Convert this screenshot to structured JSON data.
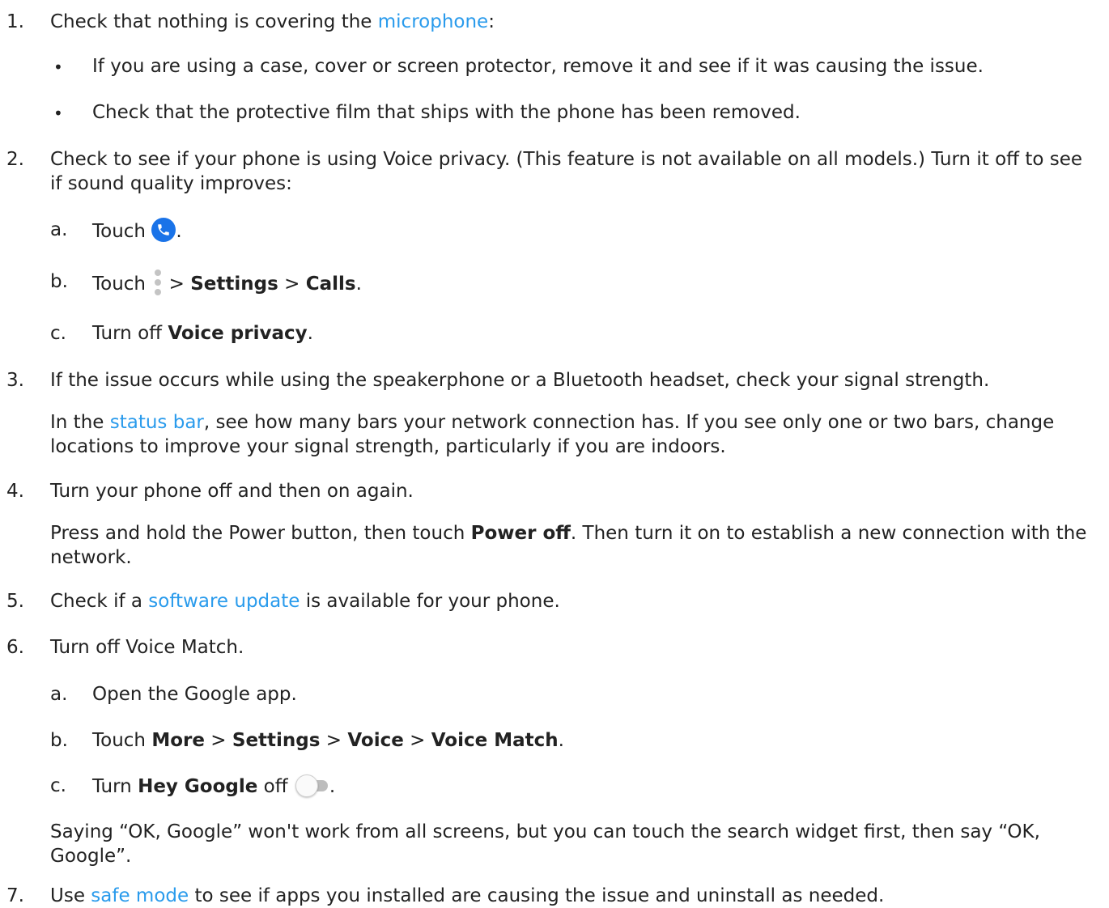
{
  "steps": [
    {
      "num": "1.",
      "text_before": "Check that nothing is covering the ",
      "link": "microphone",
      "text_after": ":",
      "bullets": [
        "If you are using a case, cover or screen protector, remove it and see if it was causing the issue.",
        "Check that the protective film that ships with the phone has been removed."
      ]
    },
    {
      "num": "2.",
      "text": "Check to see if your phone is using Voice privacy. (This feature is not available on all models.) Turn it off to see if sound quality improves:",
      "substeps": [
        {
          "label": "a.",
          "touch": "Touch",
          "end": "."
        },
        {
          "label": "b.",
          "touch": "Touch",
          "sep1": " > ",
          "settings": "Settings",
          "sep2": " > ",
          "calls": "Calls",
          "end": "."
        },
        {
          "label": "c.",
          "prefix": "Turn off ",
          "bold": "Voice privacy",
          "end": "."
        }
      ]
    },
    {
      "num": "3.",
      "text": "If the issue occurs while using the speakerphone or a Bluetooth headset, check your signal strength.",
      "para_before": "In the ",
      "para_link": "status bar",
      "para_after": ", see how many bars your network connection has. If you see only one or two bars, change locations to improve your signal strength, particularly if you are indoors."
    },
    {
      "num": "4.",
      "text": "Turn your phone off and then on again.",
      "para_before": "Press and hold the Power button, then touch ",
      "para_bold": "Power off",
      "para_after": ". Then turn it on to establish a new connection with the network."
    },
    {
      "num": "5.",
      "text_before": "Check if a ",
      "link": "software update",
      "text_after": " is available for your phone."
    },
    {
      "num": "6.",
      "text": "Turn off Voice Match.",
      "substeps": [
        {
          "label": "a.",
          "text": "Open the Google app."
        },
        {
          "label": "b.",
          "prefix": "Touch ",
          "b1": "More",
          "s1": " > ",
          "b2": "Settings",
          "s2": " > ",
          "b3": "Voice",
          "s3": " > ",
          "b4": "Voice Match",
          "end": "."
        },
        {
          "label": "c.",
          "prefix": "Turn ",
          "bold": "Hey Google",
          "mid": " off ",
          "end": "."
        }
      ],
      "note": "Saying “OK, Google” won't work from all screens, but you can touch the search widget first, then say “OK, Google”."
    },
    {
      "num": "7.",
      "text_before": "Use ",
      "link": "safe mode",
      "text_after": " to see if apps you installed are causing the issue and uninstall as needed."
    }
  ],
  "icons": {
    "phone": "phone-app-icon",
    "more": "more-vertical-icon",
    "toggle": "toggle-off-icon"
  },
  "colors": {
    "link": "#2a9bec",
    "text": "#222222",
    "phone_icon_bg": "#1a73e8"
  }
}
